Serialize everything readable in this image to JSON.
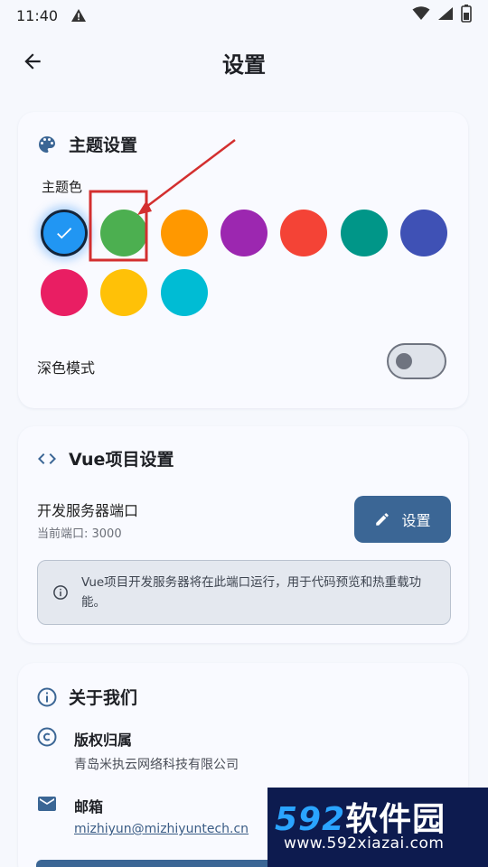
{
  "status_bar": {
    "time": "11:40"
  },
  "app_bar": {
    "title": "设置"
  },
  "theme_card": {
    "title": "主题设置",
    "color_label": "主题色",
    "swatches": [
      "#2196F3",
      "#4CAF50",
      "#FF9800",
      "#9C27B0",
      "#F44336",
      "#009688",
      "#3F51B5",
      "#E91E63",
      "#FFC107",
      "#00BCD4"
    ],
    "selected_index": 0,
    "dark_mode_label": "深色模式",
    "dark_mode_on": false
  },
  "vue_card": {
    "title": "Vue项目设置",
    "port_title": "开发服务器端口",
    "port_sub": "当前端口: 3000",
    "set_button": "设置",
    "info_text": "Vue项目开发服务器将在此端口运行，用于代码预览和热重载功能。"
  },
  "about_card": {
    "title": "关于我们",
    "copyright_title": "版权归属",
    "copyright_value": "青岛米执云网络科技有限公司",
    "email_title": "邮箱",
    "email_value": "mizhiyun@mizhiyuntech.cn"
  },
  "watermark": {
    "brand_num": "592",
    "brand_text": "软件园",
    "site": "www.592xiazai.com"
  },
  "colors": {
    "accent": "#3b6695",
    "annotation": "#d32f2f"
  }
}
